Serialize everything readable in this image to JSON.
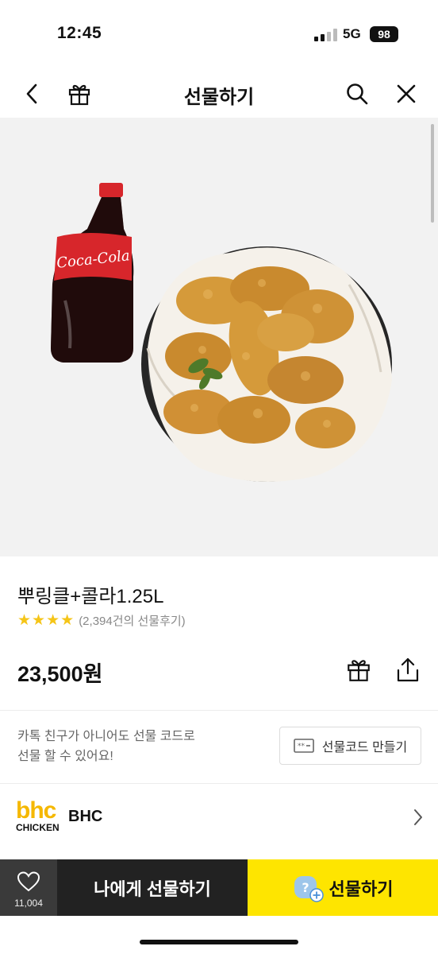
{
  "status_bar": {
    "time": "12:45",
    "network": "5G",
    "battery": "98"
  },
  "nav": {
    "title": "선물하기",
    "back_icon": "chevron-left-icon",
    "gift_icon": "gift-icon",
    "search_icon": "search-icon",
    "close_icon": "close-icon"
  },
  "product": {
    "name": "뿌링클+콜라1.25L",
    "rating_stars": 4,
    "review_count": "(2,394건의 선물후기)",
    "price": "23,500원",
    "cola_label": "Coca-Cola"
  },
  "gift_code": {
    "info_line1": "카톡 친구가 아니어도 선물 코드로",
    "info_line2": "선물 할 수 있어요!",
    "button_label": "선물코드 만들기"
  },
  "brand": {
    "logo_top": "bhc",
    "logo_bottom": "CHICKEN",
    "name": "BHC"
  },
  "bottom_bar": {
    "wish_count": "11,004",
    "self_gift_label": "나에게 선물하기",
    "gift_label": "선물하기"
  },
  "colors": {
    "accent": "#fee500",
    "star": "#f5c518",
    "brand": "#f5b800",
    "dark_button": "#222222"
  }
}
